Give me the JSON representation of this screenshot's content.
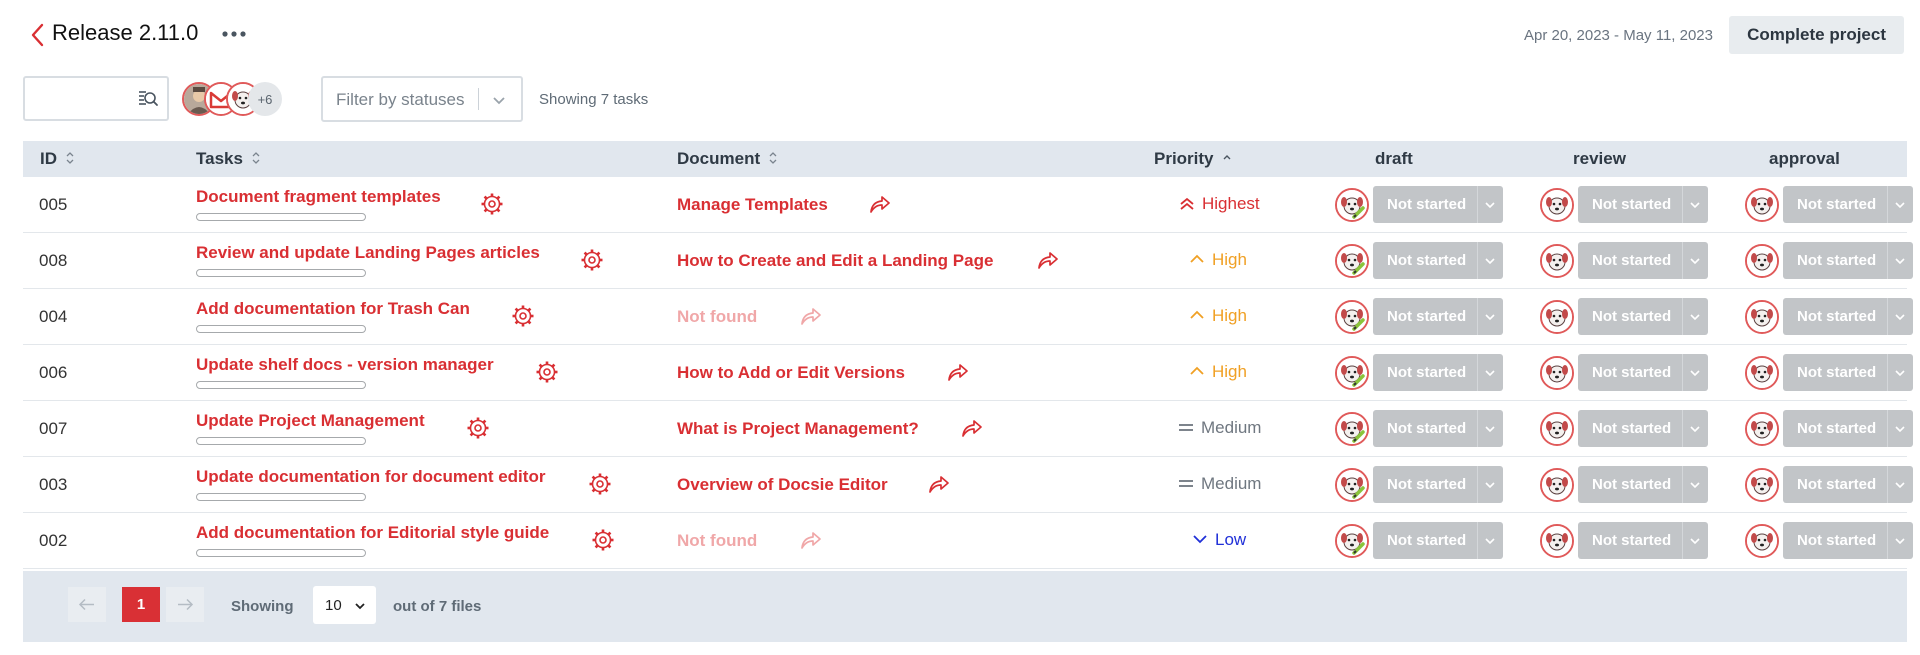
{
  "header": {
    "title": "Release 2.11.0",
    "date_range": "Apr 20, 2023 - May 11, 2023",
    "complete_button": "Complete project"
  },
  "toolbar": {
    "search_placeholder": "",
    "extra_assignees": "+6",
    "status_filter_placeholder": "Filter by statuses",
    "showing_text": "Showing 7 tasks"
  },
  "columns": {
    "id": "ID",
    "tasks": "Tasks",
    "document": "Document",
    "priority": "Priority",
    "draft": "draft",
    "review": "review",
    "approval": "approval"
  },
  "colors": {
    "accent": "#d92f33",
    "not_found": "#f0a7a8",
    "priority_highest": "#d92f33",
    "priority_high": "#f0a024",
    "priority_medium": "#6f7780",
    "priority_low": "#2030d8"
  },
  "rows": [
    {
      "id": "005",
      "task": "Document fragment templates",
      "document": "Manage Templates",
      "doc_found": true,
      "priority": "Highest",
      "priority_level": "highest",
      "draft": "Not started",
      "review": "Not started",
      "approval": "Not started"
    },
    {
      "id": "008",
      "task": "Review and update Landing Pages articles",
      "document": "How to Create and Edit a Landing Page",
      "doc_found": true,
      "priority": "High",
      "priority_level": "high",
      "draft": "Not started",
      "review": "Not started",
      "approval": "Not started"
    },
    {
      "id": "004",
      "task": "Add documentation for Trash Can",
      "document": "Not found",
      "doc_found": false,
      "priority": "High",
      "priority_level": "high",
      "draft": "Not started",
      "review": "Not started",
      "approval": "Not started"
    },
    {
      "id": "006",
      "task": "Update shelf docs - version manager",
      "document": "How to Add or Edit Versions",
      "doc_found": true,
      "priority": "High",
      "priority_level": "high",
      "draft": "Not started",
      "review": "Not started",
      "approval": "Not started"
    },
    {
      "id": "007",
      "task": "Update Project Management",
      "document": "What is Project Management?",
      "doc_found": true,
      "priority": "Medium",
      "priority_level": "medium",
      "draft": "Not started",
      "review": "Not started",
      "approval": "Not started"
    },
    {
      "id": "003",
      "task": "Update documentation for document editor",
      "document": "Overview of Docsie Editor",
      "doc_found": true,
      "priority": "Medium",
      "priority_level": "medium",
      "draft": "Not started",
      "review": "Not started",
      "approval": "Not started"
    },
    {
      "id": "002",
      "task": "Add documentation for Editorial style guide",
      "document": "Not found",
      "doc_found": false,
      "priority": "Low",
      "priority_level": "low",
      "draft": "Not started",
      "review": "Not started",
      "approval": "Not started"
    }
  ],
  "footer": {
    "current_page": "1",
    "showing_label": "Showing",
    "page_size": "10",
    "out_of": "out of 7 files"
  }
}
